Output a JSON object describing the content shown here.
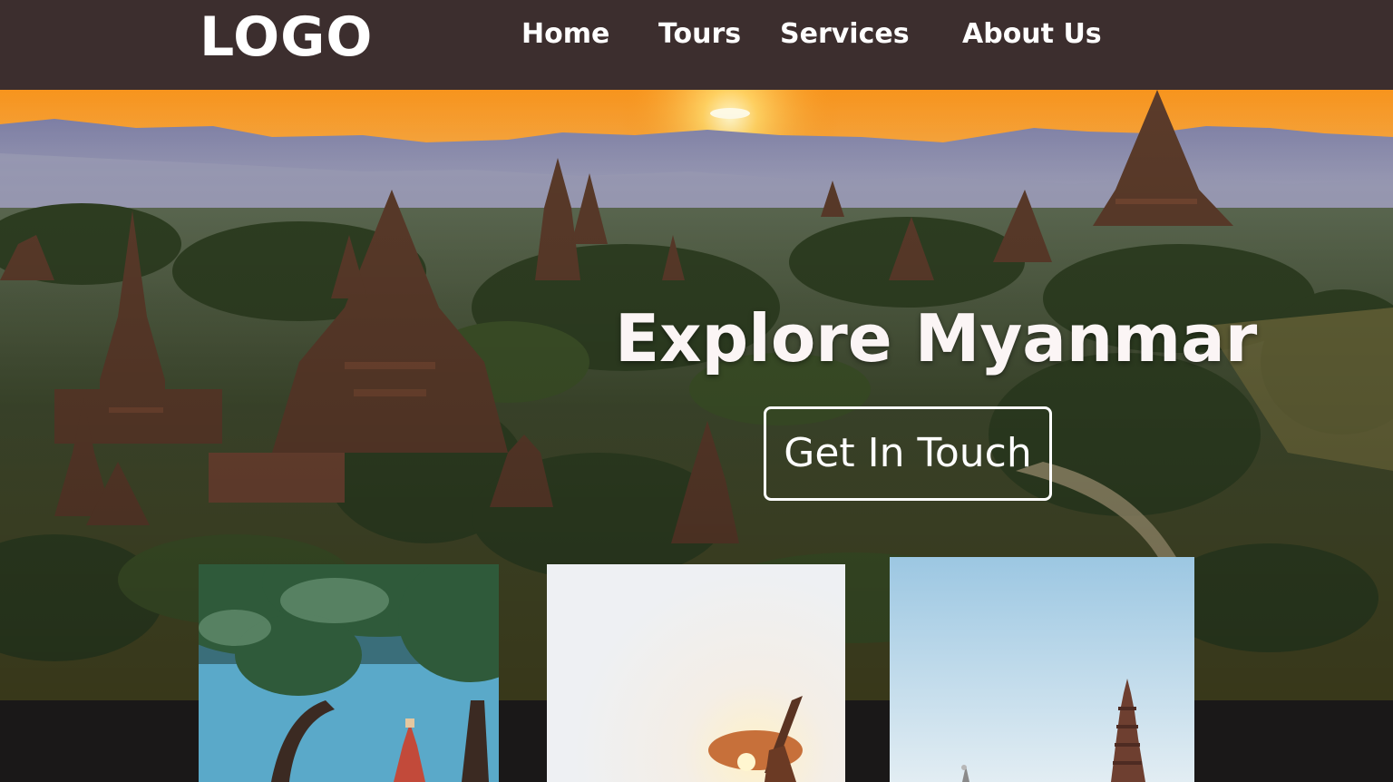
{
  "nav": {
    "logo": "LOGO",
    "links": [
      {
        "label": "Home"
      },
      {
        "label": "Tours"
      },
      {
        "label": "Services"
      },
      {
        "label": "About Us"
      }
    ]
  },
  "hero": {
    "title": "Explore Myanmar",
    "cta_label": "Get In Touch",
    "image": "bagan-temples-sunset"
  },
  "cards": [
    {
      "image": "tree-and-pagoda"
    },
    {
      "image": "fisherman-silhouette-sunlight"
    },
    {
      "image": "stupa-against-sky"
    }
  ],
  "colors": {
    "navbar": "#3c2e2e",
    "page_background": "#1a1818",
    "text": "#ffffff"
  }
}
